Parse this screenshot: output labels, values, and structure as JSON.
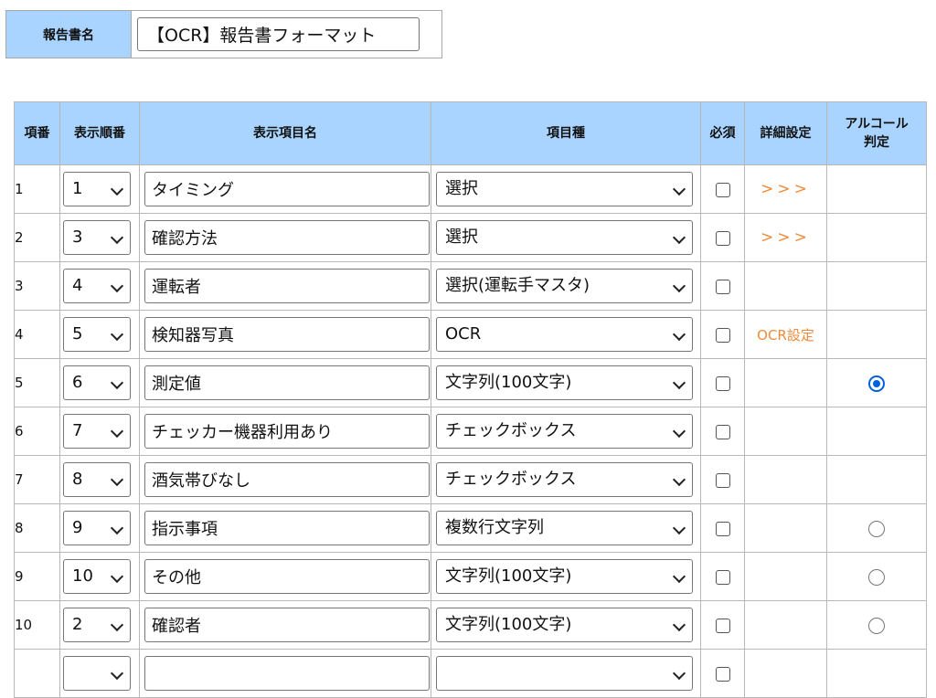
{
  "report": {
    "label": "報告書名",
    "name": "【OCR】報告書フォーマット"
  },
  "table": {
    "headers": [
      "項番",
      "表示順番",
      "表示項目名",
      "項目種",
      "必須",
      "詳細設定",
      "アルコール",
      "判定"
    ],
    "rows": [
      {
        "no": "1",
        "order": "1",
        "name": "タイミング",
        "type": "選択",
        "required": false,
        "detail": ">>>",
        "alcohol": null
      },
      {
        "no": "2",
        "order": "3",
        "name": "確認方法",
        "type": "選択",
        "required": false,
        "detail": ">>>",
        "alcohol": null
      },
      {
        "no": "3",
        "order": "4",
        "name": "運転者",
        "type": "選択(運転手マスタ)",
        "required": false,
        "detail": "",
        "alcohol": null
      },
      {
        "no": "4",
        "order": "5",
        "name": "検知器写真",
        "type": "OCR",
        "required": false,
        "detail": "OCR設定",
        "alcohol": null
      },
      {
        "no": "5",
        "order": "6",
        "name": "測定値",
        "type": "文字列(100文字)",
        "required": false,
        "detail": "",
        "alcohol": true
      },
      {
        "no": "6",
        "order": "7",
        "name": "チェッカー機器利用あり",
        "type": "チェックボックス",
        "required": false,
        "detail": "",
        "alcohol": null
      },
      {
        "no": "7",
        "order": "8",
        "name": "酒気帯びなし",
        "type": "チェックボックス",
        "required": false,
        "detail": "",
        "alcohol": null
      },
      {
        "no": "8",
        "order": "9",
        "name": "指示事項",
        "type": "複数行文字列",
        "required": false,
        "detail": "",
        "alcohol": false
      },
      {
        "no": "9",
        "order": "10",
        "name": "その他",
        "type": "文字列(100文字)",
        "required": false,
        "detail": "",
        "alcohol": false
      },
      {
        "no": "10",
        "order": "2",
        "name": "確認者",
        "type": "文字列(100文字)",
        "required": false,
        "detail": "",
        "alcohol": false
      },
      {
        "no": "",
        "order": "",
        "name": "",
        "type": "",
        "required": false,
        "detail": "",
        "alcohol": null
      }
    ]
  },
  "icons": {
    "dropdown": "chevron-down-icon"
  },
  "colors": {
    "header_bg": "#a9d4ff",
    "link": "#ef8a3a",
    "radio_selected": "#0060df"
  }
}
